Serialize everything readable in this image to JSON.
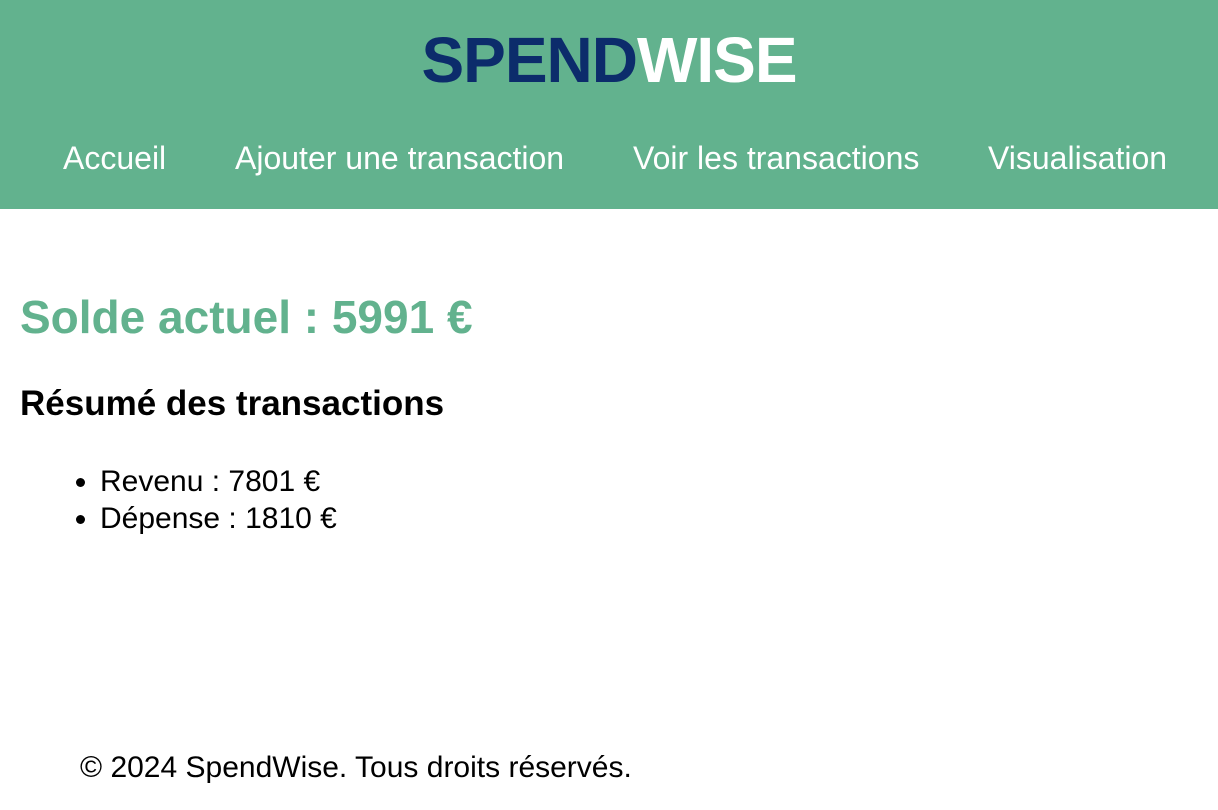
{
  "header": {
    "logo_part1": "SPEND",
    "logo_part2": "WISE",
    "background_color": "#62b28e",
    "logo_part1_color": "#0c2c6b",
    "logo_part2_color": "#ffffff"
  },
  "nav": {
    "items": [
      {
        "label": "Accueil"
      },
      {
        "label": "Ajouter une transaction"
      },
      {
        "label": "Voir les transactions"
      },
      {
        "label": "Visualisation"
      }
    ]
  },
  "main": {
    "balance_text": "Solde actuel : 5991 €",
    "summary_title": "Résumé des transactions",
    "summary_items": [
      {
        "text": "Revenu : 7801 €"
      },
      {
        "text": "Dépense : 1810 €"
      }
    ]
  },
  "footer": {
    "text": "© 2024 SpendWise. Tous droits réservés."
  }
}
